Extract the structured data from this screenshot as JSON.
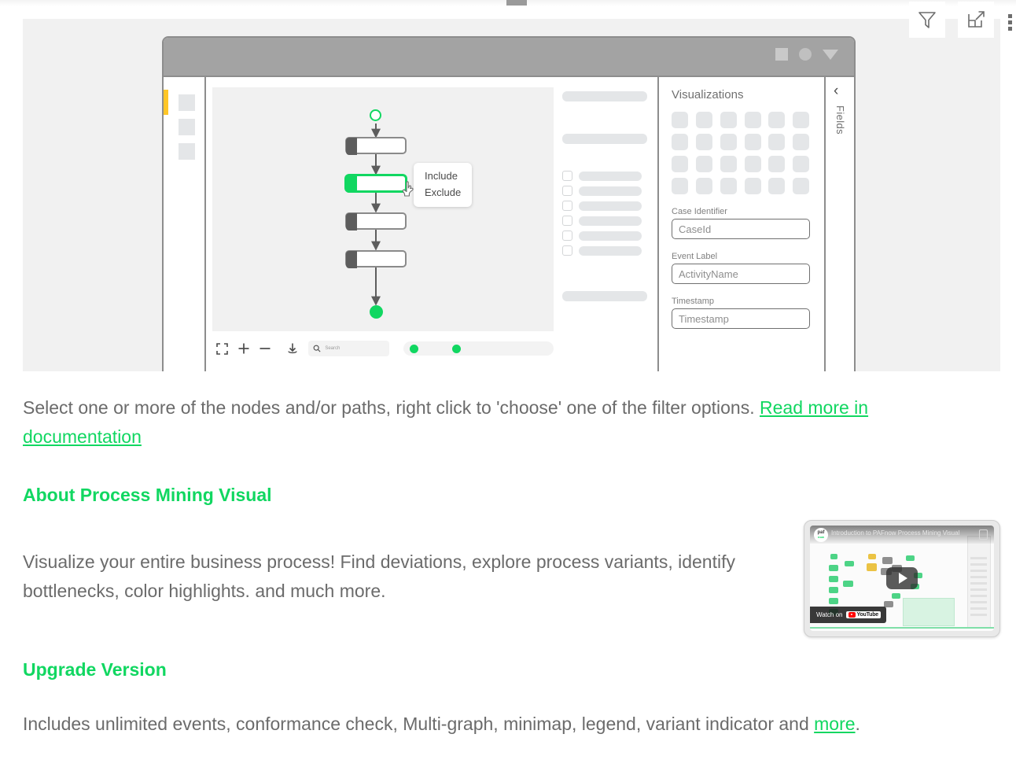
{
  "header": {
    "icons": [
      {
        "name": "filter-icon",
        "label": "Filter"
      },
      {
        "name": "focus-mode-icon",
        "label": "Focus mode"
      },
      {
        "name": "more-options-icon",
        "label": "More options"
      }
    ]
  },
  "illustration": {
    "window": {
      "titlebar_controls": [
        "square",
        "circle",
        "caret-down"
      ],
      "rail_items": [
        "item-1",
        "item-2",
        "item-3"
      ],
      "context_menu": {
        "include_label": "Include",
        "exclude_label": "Exclude"
      },
      "toolbar": {
        "fit_label": "Fit to screen",
        "zoom_in_label": "+",
        "zoom_out_label": "−",
        "download_label": "Download",
        "search_placeholder": "Search"
      },
      "viz_pane": {
        "title": "Visualizations",
        "fields": [
          {
            "label": "Case Identifier",
            "value": "CaseId"
          },
          {
            "label": "Event Label",
            "value": "ActivityName"
          },
          {
            "label": "Timestamp",
            "value": "Timestamp"
          }
        ]
      },
      "fields_rail": {
        "label": "Fields",
        "collapse_icon": "‹"
      }
    }
  },
  "content": {
    "intro": {
      "text": "Select one or more of the nodes and/or paths, right click to 'choose' one of the filter options. ",
      "link_text": "Read more in documentation"
    },
    "about": {
      "title": "About Process Mining Visual",
      "body": "Visualize your entire business process! Find deviations, explore process variants, identify bottlenecks, color highlights. and much more."
    },
    "upgrade": {
      "title": "Upgrade Version",
      "body_before": "Includes unlimited events, conformance check, Multi-graph, minimap, legend, variant indicator and ",
      "link_text": "more",
      "body_after": "."
    }
  },
  "video": {
    "title": "Introduction to PAFnow Process Mining Visual",
    "logo_line1": "paf",
    "logo_line2": "now",
    "watch_on_label": "Watch on",
    "provider": "YouTube",
    "play_label": "Play"
  },
  "colors": {
    "accent_green": "#11d761",
    "text_gray": "#6b6b6b",
    "panel_gray": "#f1f1f1",
    "accent_yellow": "#ffc627"
  }
}
